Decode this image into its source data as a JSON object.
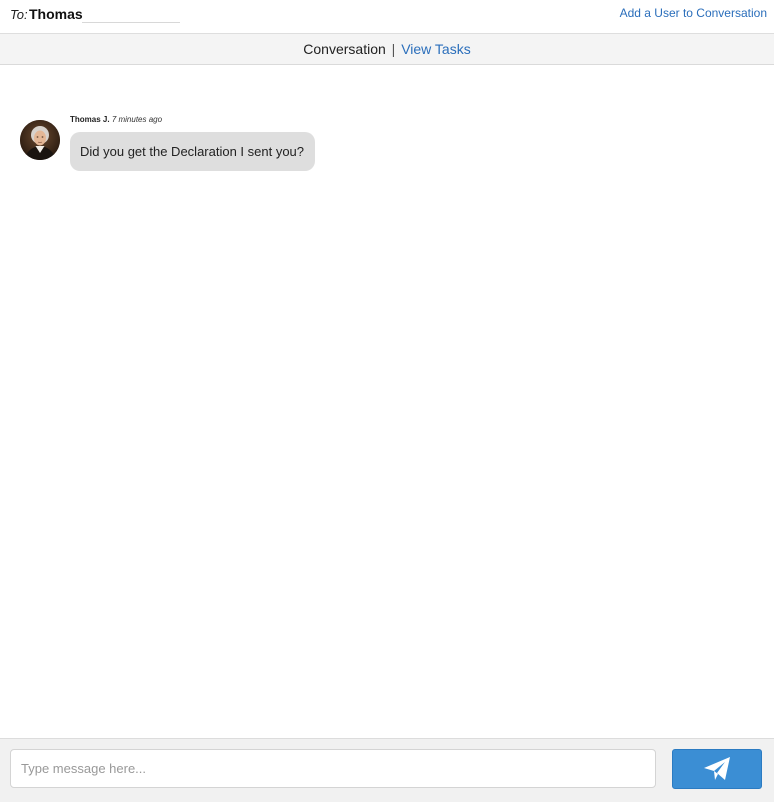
{
  "header": {
    "to_label": "To:",
    "recipient": "Thomas",
    "recipient_input_value": "",
    "add_user_link": "Add a User to Conversation"
  },
  "tabs": {
    "active": "Conversation",
    "separator": "|",
    "other": "View Tasks"
  },
  "messages": [
    {
      "author": "Thomas J.",
      "time": "7 minutes ago",
      "text": "Did you get the Declaration I sent you?",
      "avatar_icon": "portrait-avatar"
    }
  ],
  "composer": {
    "placeholder": "Type message here...",
    "value": "",
    "send_icon": "paper-plane-icon"
  },
  "colors": {
    "link": "#2a6ebb",
    "send_button": "#3b8ed4",
    "bubble": "#dedede",
    "bar_background": "#f4f4f4"
  }
}
